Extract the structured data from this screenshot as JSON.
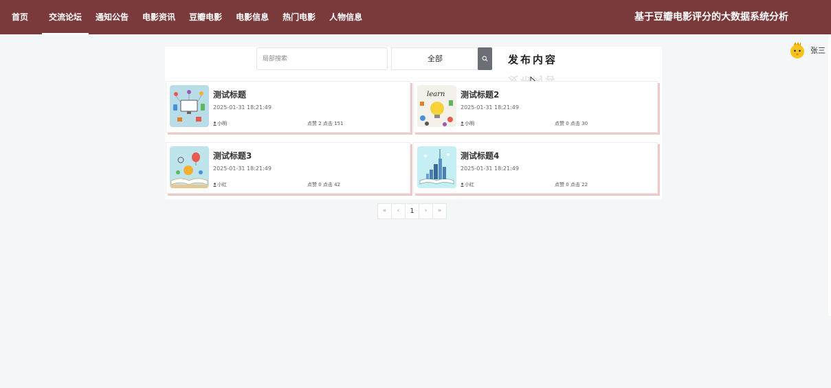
{
  "nav": {
    "items": [
      {
        "label": "首页",
        "active": false
      },
      {
        "label": "交流论坛",
        "active": true
      },
      {
        "label": "通知公告",
        "active": false
      },
      {
        "label": "电影资讯",
        "active": false
      },
      {
        "label": "豆瓣电影",
        "active": false
      },
      {
        "label": "电影信息",
        "active": false
      },
      {
        "label": "热门电影",
        "active": false
      },
      {
        "label": "人物信息",
        "active": false
      }
    ],
    "site_title": "基于豆瓣电影评分的大数据系统分析"
  },
  "user": {
    "name": "张三",
    "avatar_icon": "yellow-chick-avatar-icon"
  },
  "search": {
    "placeholder": "局部搜索",
    "value": "",
    "select_value": "全部",
    "button_icon": "search-icon"
  },
  "publish_label": "发布内容",
  "posts": [
    {
      "title": "测试标题",
      "date": "2025-01-31 18:21:49",
      "author": "小明",
      "stats": "点赞 2 点击 151",
      "thumb_icon": "tech-devices-illustration"
    },
    {
      "title": "测试标题2",
      "date": "2025-01-31 18:21:49",
      "author": "小明",
      "stats": "点赞 0 点击 30",
      "thumb_icon": "learn-lightbulb-illustration"
    },
    {
      "title": "测试标题3",
      "date": "2025-01-31 18:21:49",
      "author": "小红",
      "stats": "点赞 0 点击 42",
      "thumb_icon": "open-book-balloon-illustration"
    },
    {
      "title": "测试标题4",
      "date": "2025-01-31 18:21:49",
      "author": "小红",
      "stats": "点赞 0 点击 22",
      "thumb_icon": "open-book-city-illustration"
    }
  ],
  "pagination": {
    "first": "«",
    "prev": "‹",
    "current": "1",
    "next": "›",
    "last": "»"
  },
  "colors": {
    "nav_bg": "#7a3a3b",
    "card_shadow": "#edcaca",
    "search_btn": "#6b6f75",
    "page_bg": "#f3f7f7"
  }
}
